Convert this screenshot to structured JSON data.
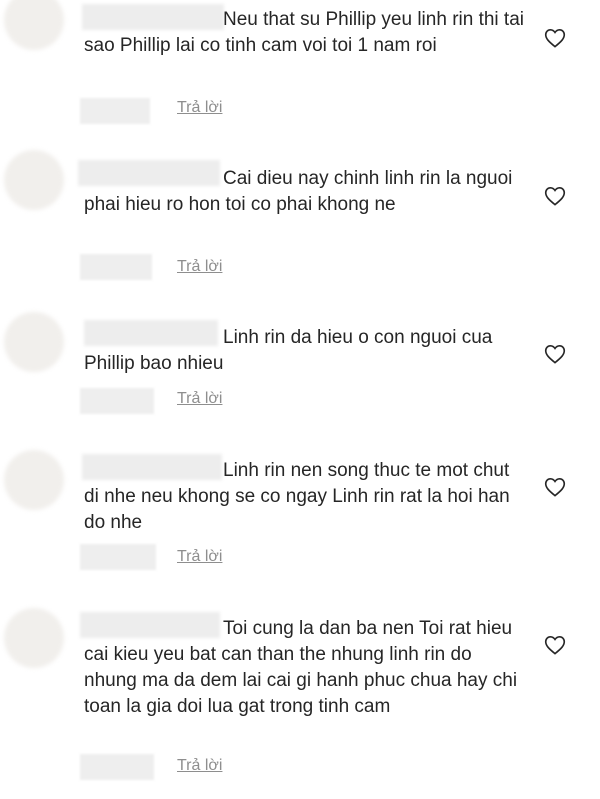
{
  "comments": [
    {
      "text": "Neu that su Phillip yeu linh rin thi tai sao Phillip lai co tinh cam voi toi 1 nam roi",
      "reply_label": "Trả lời"
    },
    {
      "text": "Cai dieu nay chinh linh rin la nguoi phai hieu ro hon toi co phai khong ne",
      "reply_label": "Trả lời"
    },
    {
      "text": "Linh rin da hieu o con nguoi cua Phillip bao nhieu",
      "reply_label": "Trả lời"
    },
    {
      "text": "Linh rin nen song thuc te mot chut di nhe neu khong se co ngay Linh rin rat la hoi han do nhe",
      "reply_label": "Trả lời"
    },
    {
      "text": "Toi cung la dan ba nen Toi rat hieu cai kieu yeu bat can than the nhung linh rin do nhung ma da dem lai cai gi hanh phuc chua hay chi toan la gia doi lua gat trong tinh cam",
      "reply_label": "Trả lời"
    }
  ],
  "icons": {
    "like": "heart-outline-icon"
  }
}
